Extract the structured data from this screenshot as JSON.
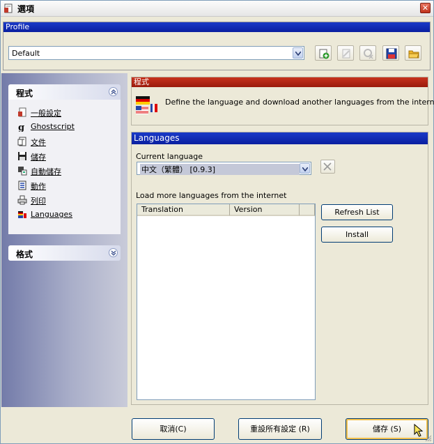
{
  "window": {
    "title": "選項"
  },
  "profile": {
    "header": "Profile",
    "selected": "Default",
    "toolbar": [
      "add-profile-icon",
      "rename-profile-icon",
      "delete-profile-icon",
      "save-profile-icon",
      "open-profile-icon"
    ]
  },
  "sidebar": {
    "program_panel": {
      "title": "程式"
    },
    "items": [
      {
        "label": "一般設定",
        "icon": "general-settings-icon"
      },
      {
        "label": "Ghostscript",
        "icon": "ghostscript-icon"
      },
      {
        "label": "文件",
        "icon": "document-icon"
      },
      {
        "label": "儲存",
        "icon": "save-icon"
      },
      {
        "label": "自動儲存",
        "icon": "autosave-icon"
      },
      {
        "label": "動作",
        "icon": "actions-icon"
      },
      {
        "label": "列印",
        "icon": "print-icon"
      },
      {
        "label": "Languages",
        "icon": "languages-icon"
      }
    ],
    "format_panel": {
      "title": "格式"
    }
  },
  "program_section": {
    "header": "程式",
    "description": "Define the language and download another languages from the internet."
  },
  "languages": {
    "header": "Languages",
    "current_label": "Current language",
    "current_value": "中文（繁體） [0.9.3]",
    "load_more_label": "Load more languages from the internet",
    "columns": [
      "Translation",
      "Version"
    ],
    "refresh_label": "Refresh List",
    "install_label": "Install"
  },
  "footer": {
    "cancel_label": "取消(C)",
    "reset_label": "重設所有設定 (R)",
    "save_label": "儲存 (S)"
  },
  "colors": {
    "header_blue": "#0a1fa0",
    "header_red": "#9a1a0c",
    "window_bg": "#ece9d8"
  }
}
